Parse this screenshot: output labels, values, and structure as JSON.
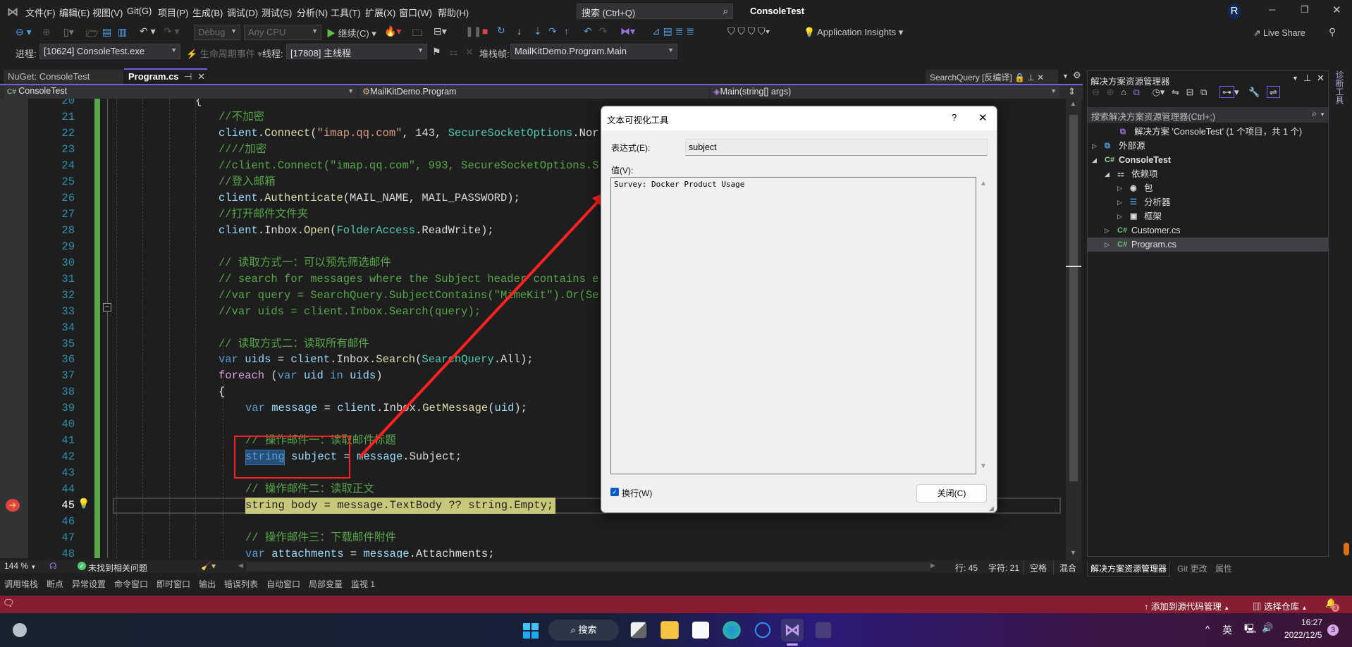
{
  "menu": {
    "items": [
      "文件(F)",
      "编辑(E)",
      "视图(V)",
      "Git(G)",
      "项目(P)",
      "生成(B)",
      "调试(D)",
      "测试(S)",
      "分析(N)",
      "工具(T)",
      "扩展(X)",
      "窗口(W)",
      "帮助(H)"
    ],
    "search_placeholder": "搜索 (Ctrl+Q)",
    "window_title": "ConsoleTest",
    "avatar_letter": "R"
  },
  "toolbar": {
    "config": "Debug",
    "platform": "Any CPU",
    "continue_label": "继续(C)",
    "app_insights": "Application Insights",
    "live_share": "Live Share",
    "process_label": "进程:",
    "process_value": "[10624] ConsoleTest.exe",
    "lifecycle_label": "生命周期事件",
    "thread_label": "线程:",
    "thread_value": "[17808] 主线程",
    "stack_label": "堆栈帧:",
    "stack_value": "MailKitDemo.Program.Main"
  },
  "tabs": [
    {
      "label": "NuGet: ConsoleTest",
      "active": false
    },
    {
      "label": "Program.cs",
      "active": true
    }
  ],
  "preview_tab": "SearchQuery [反编译]",
  "navbar": {
    "project": "ConsoleTest",
    "class": "MailKitDemo.Program",
    "member": "Main(string[] args)"
  },
  "code": {
    "current_line": 45,
    "lines": [
      {
        "n": 20,
        "indent": 4,
        "tokens": [
          {
            "t": "{",
            "c": "pl"
          }
        ]
      },
      {
        "n": 21,
        "indent": 5,
        "tokens": [
          {
            "t": "//不加密",
            "c": "cm"
          }
        ]
      },
      {
        "n": 22,
        "indent": 5,
        "tokens": [
          {
            "t": "client",
            "c": "id"
          },
          {
            "t": ".",
            "c": "pl"
          },
          {
            "t": "Connect",
            "c": "mt"
          },
          {
            "t": "(",
            "c": "pl"
          },
          {
            "t": "\"imap.qq.com\"",
            "c": "st"
          },
          {
            "t": ", 143, ",
            "c": "pl"
          },
          {
            "t": "SecureSocketOptions",
            "c": "ty"
          },
          {
            "t": ".Nor",
            "c": "pl"
          }
        ]
      },
      {
        "n": 23,
        "indent": 5,
        "tokens": [
          {
            "t": "////加密",
            "c": "cm"
          }
        ]
      },
      {
        "n": 24,
        "indent": 5,
        "tokens": [
          {
            "t": "//client.Connect(\"imap.qq.com\", 993, SecureSocketOptions.S",
            "c": "cm"
          }
        ]
      },
      {
        "n": 25,
        "indent": 5,
        "tokens": [
          {
            "t": "//登入邮箱",
            "c": "cm"
          }
        ]
      },
      {
        "n": 26,
        "indent": 5,
        "tokens": [
          {
            "t": "client",
            "c": "id"
          },
          {
            "t": ".",
            "c": "pl"
          },
          {
            "t": "Authenticate",
            "c": "mt"
          },
          {
            "t": "(MAIL_NAME, MAIL_PASSWORD);",
            "c": "pl"
          }
        ]
      },
      {
        "n": 27,
        "indent": 5,
        "tokens": [
          {
            "t": "//打开邮件文件夹",
            "c": "cm"
          }
        ]
      },
      {
        "n": 28,
        "indent": 5,
        "tokens": [
          {
            "t": "client",
            "c": "id"
          },
          {
            "t": ".Inbox.",
            "c": "pl"
          },
          {
            "t": "Open",
            "c": "mt"
          },
          {
            "t": "(",
            "c": "pl"
          },
          {
            "t": "FolderAccess",
            "c": "ty"
          },
          {
            "t": ".ReadWrite);",
            "c": "pl"
          }
        ]
      },
      {
        "n": 29,
        "indent": 5,
        "tokens": []
      },
      {
        "n": 30,
        "indent": 5,
        "tokens": [
          {
            "t": "// 读取方式一：可以预先筛选邮件",
            "c": "cm"
          }
        ]
      },
      {
        "n": 31,
        "indent": 5,
        "tokens": [
          {
            "t": "// search for messages where the Subject header contains e",
            "c": "cm"
          }
        ]
      },
      {
        "n": 32,
        "indent": 5,
        "tokens": [
          {
            "t": "//var query = SearchQuery.SubjectContains(\"MimeKit\").Or(Se",
            "c": "cm"
          }
        ]
      },
      {
        "n": 33,
        "indent": 5,
        "tokens": [
          {
            "t": "//var uids = client.Inbox.Search(query);",
            "c": "cm"
          }
        ]
      },
      {
        "n": 34,
        "indent": 5,
        "tokens": []
      },
      {
        "n": 35,
        "indent": 5,
        "tokens": [
          {
            "t": "// 读取方式二：读取所有邮件",
            "c": "cm"
          }
        ]
      },
      {
        "n": 36,
        "indent": 5,
        "tokens": [
          {
            "t": "var ",
            "c": "kw"
          },
          {
            "t": "uids",
            "c": "id"
          },
          {
            "t": " = ",
            "c": "pl"
          },
          {
            "t": "client",
            "c": "id"
          },
          {
            "t": ".Inbox.",
            "c": "pl"
          },
          {
            "t": "Search",
            "c": "mt"
          },
          {
            "t": "(",
            "c": "pl"
          },
          {
            "t": "SearchQuery",
            "c": "ty"
          },
          {
            "t": ".All);",
            "c": "pl"
          }
        ]
      },
      {
        "n": 37,
        "indent": 5,
        "tokens": [
          {
            "t": "foreach",
            "c": "ct"
          },
          {
            "t": " (",
            "c": "pl"
          },
          {
            "t": "var ",
            "c": "kw"
          },
          {
            "t": "uid ",
            "c": "id"
          },
          {
            "t": "in ",
            "c": "kw"
          },
          {
            "t": "uids",
            "c": "id"
          },
          {
            "t": ")",
            "c": "pl"
          }
        ]
      },
      {
        "n": 38,
        "indent": 5,
        "tokens": [
          {
            "t": "{",
            "c": "pl"
          }
        ]
      },
      {
        "n": 39,
        "indent": 6,
        "tokens": [
          {
            "t": "var ",
            "c": "kw"
          },
          {
            "t": "message",
            "c": "id"
          },
          {
            "t": " = ",
            "c": "pl"
          },
          {
            "t": "client",
            "c": "id"
          },
          {
            "t": ".Inbox.",
            "c": "pl"
          },
          {
            "t": "GetMessage",
            "c": "mt"
          },
          {
            "t": "(",
            "c": "pl"
          },
          {
            "t": "uid",
            "c": "id"
          },
          {
            "t": ");",
            "c": "pl"
          }
        ]
      },
      {
        "n": 40,
        "indent": 6,
        "tokens": []
      },
      {
        "n": 41,
        "indent": 6,
        "tokens": [
          {
            "t": "// 操作邮件一：读取邮件标题",
            "c": "cm"
          }
        ]
      },
      {
        "n": 42,
        "indent": 6,
        "tokens": [
          {
            "t": "string",
            "c": "kw"
          },
          {
            "t": " ",
            "c": "pl"
          },
          {
            "t": "subject",
            "c": "id"
          },
          {
            "t": " = ",
            "c": "pl"
          },
          {
            "t": "message",
            "c": "id"
          },
          {
            "t": ".Subject;",
            "c": "pl"
          }
        ]
      },
      {
        "n": 43,
        "indent": 6,
        "tokens": []
      },
      {
        "n": 44,
        "indent": 6,
        "tokens": [
          {
            "t": "// 操作邮件二：读取正文",
            "c": "cm"
          }
        ]
      },
      {
        "n": 45,
        "indent": 6,
        "tokens": [
          {
            "t": "string body = message.TextBody ?? string.Empty;",
            "c": "pl"
          }
        ]
      },
      {
        "n": 46,
        "indent": 6,
        "tokens": []
      },
      {
        "n": 47,
        "indent": 6,
        "tokens": [
          {
            "t": "// 操作邮件三：下载邮件附件",
            "c": "cm"
          }
        ]
      },
      {
        "n": 48,
        "indent": 6,
        "tokens": [
          {
            "t": "var ",
            "c": "kw"
          },
          {
            "t": "attachments",
            "c": "id"
          },
          {
            "t": " = ",
            "c": "pl"
          },
          {
            "t": "message",
            "c": "id"
          },
          {
            "t": ".Attachments;",
            "c": "pl"
          }
        ]
      }
    ]
  },
  "dialog": {
    "title": "文本可视化工具",
    "help": "?",
    "expression_label": "表达式(E):",
    "expression_value": "subject",
    "value_label": "值(V):",
    "value_text": "Survey: Docker Product Usage",
    "wrap_label": "换行(W)",
    "wrap_checked": true,
    "close_button": "关闭(C)"
  },
  "solution_explorer": {
    "title": "解决方案资源管理器",
    "search_placeholder": "搜索解决方案资源管理器(Ctrl+;)",
    "items": [
      {
        "label": "解决方案 'ConsoleTest' (1 个项目，共 1 个)",
        "icon": "solution-icon"
      },
      {
        "label": "外部源",
        "icon": "external-sources-icon"
      },
      {
        "label": "ConsoleTest",
        "icon": "csharp-project-icon"
      },
      {
        "label": "依赖项",
        "icon": "dependencies-icon"
      },
      {
        "label": "包",
        "icon": "package-icon"
      },
      {
        "label": "分析器",
        "icon": "analyzer-icon"
      },
      {
        "label": "框架",
        "icon": "framework-icon"
      },
      {
        "label": "Customer.cs",
        "icon": "csharp-file-icon"
      },
      {
        "label": "Program.cs",
        "icon": "csharp-file-icon",
        "selected": true
      }
    ],
    "bottom_tabs": [
      "解决方案资源管理器",
      "Git 更改",
      "属性"
    ],
    "side_tab": "诊断工具"
  },
  "statusbar": {
    "zoom": "144 %",
    "issues": "未找到相关问题",
    "line": "行: 45",
    "char": "字符: 21",
    "spaces": "空格",
    "line_ending": "混合"
  },
  "bottom_tabs": [
    "调用堆栈",
    "断点",
    "异常设置",
    "命令窗口",
    "即时窗口",
    "输出",
    "错误列表",
    "自动窗口",
    "局部变量",
    "监视 1"
  ],
  "redbar": {
    "add_source_control": "添加到源代码管理",
    "select_repo": "选择仓库",
    "notifications": "3"
  },
  "taskbar": {
    "search": "搜索",
    "ime": "英",
    "time": "16:27",
    "date": "2022/12/5",
    "badge": "3"
  },
  "colors": {
    "accent": "#7160e8",
    "redbar": "#861d30",
    "annotation": "#ff2020",
    "current_line_highlight": "#c9c77a"
  }
}
